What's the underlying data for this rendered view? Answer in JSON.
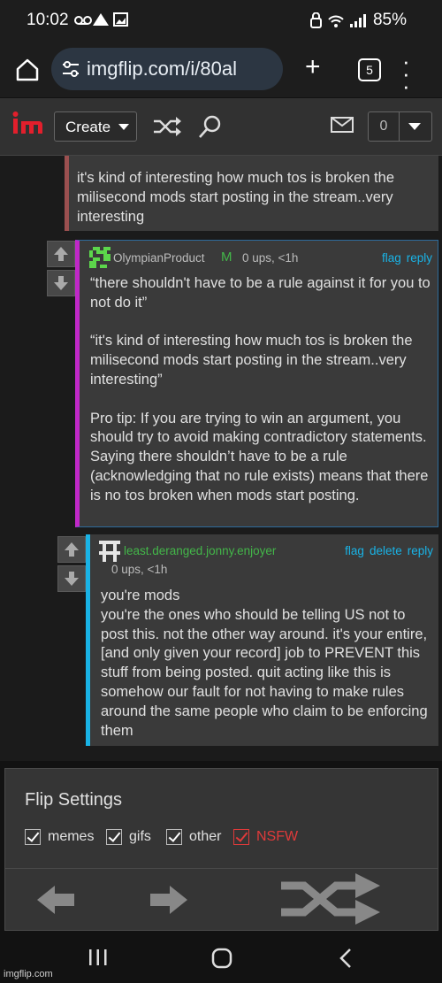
{
  "status_bar": {
    "time": "10:02",
    "battery": "85%"
  },
  "browser": {
    "url": "imgflip.com/i/80al",
    "tab_count": "5"
  },
  "site_header": {
    "create_label": "Create",
    "notif_count": "0"
  },
  "comments": [
    {
      "text": "it's kind of interesting how much tos is broken the milisecond mods start posting in the stream..very interesting"
    },
    {
      "username": "OlympianProduct",
      "mod_badge": "M",
      "meta": "0 ups, <1h",
      "actions": {
        "flag": "flag",
        "reply": "reply"
      },
      "text": "“there shouldn't have to be a rule against it for you to not do it”\n\n“it's kind of interesting how much tos is broken the milisecond mods start posting in the stream..very interesting”\n\nPro tip: If you are trying to win an argument, you should try to avoid making contradictory statements. Saying there shouldn’t have to be a rule (acknowledging that no rule exists) means that there is no tos broken when mods start posting."
    },
    {
      "username": "least.deranged.jonny.enjoyer",
      "meta": "0 ups, <1h",
      "actions": {
        "flag": "flag",
        "delete": "delete",
        "reply": "reply"
      },
      "text": "you're mods\nyou're the ones who should be telling US not to post this. not the other way around. it's your entire, [and only given your record] job to PREVENT this stuff from being posted. quit acting like this is somehow our fault for not having to make rules around the same people who claim to be enforcing them"
    }
  ],
  "flip_settings": {
    "title": "Flip Settings",
    "options": {
      "memes": "memes",
      "gifs": "gifs",
      "other": "other",
      "nsfw": "NSFW"
    }
  },
  "footer": {
    "watermark": "imgflip.com"
  },
  "colors": {
    "accent_link": "#19b3e6",
    "nsfw_red": "#e03a3a",
    "username_green": "#43b649"
  }
}
